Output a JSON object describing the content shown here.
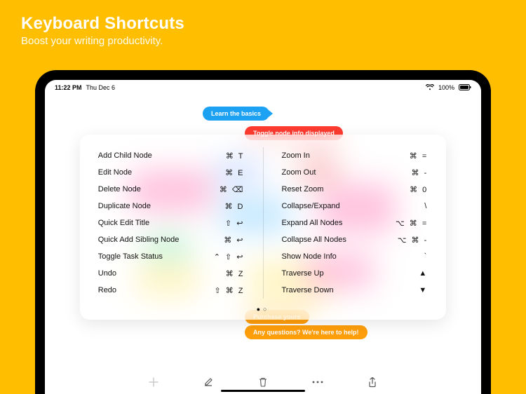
{
  "promo": {
    "title": "Keyboard Shortcuts",
    "subtitle": "Boost your writing productivity."
  },
  "statusBar": {
    "time": "11:22 PM",
    "date": "Thu Dec 6",
    "battery": "100%"
  },
  "background_nodes": {
    "learn_basics": "Learn the basics",
    "toggle_info": "Toggle node info displayed",
    "purchase": "Purchase yours",
    "questions": "Any questions? We're here to help!"
  },
  "shortcuts": {
    "left": [
      {
        "label": "Add Child Node",
        "keys": "⌘ T"
      },
      {
        "label": "Edit Node",
        "keys": "⌘ E"
      },
      {
        "label": "Delete Node",
        "keys": "⌘ ⌫"
      },
      {
        "label": "Duplicate Node",
        "keys": "⌘ D"
      },
      {
        "label": "Quick Edit Title",
        "keys": "⇧ ↩"
      },
      {
        "label": "Quick Add Sibling Node",
        "keys": "⌘ ↩"
      },
      {
        "label": "Toggle Task Status",
        "keys": "⌃ ⇧ ↩"
      },
      {
        "label": "Undo",
        "keys": "⌘ Z"
      },
      {
        "label": "Redo",
        "keys": "⇧ ⌘ Z"
      }
    ],
    "right": [
      {
        "label": "Zoom In",
        "keys": "⌘ ="
      },
      {
        "label": "Zoom Out",
        "keys": "⌘ -"
      },
      {
        "label": "Reset Zoom",
        "keys": "⌘ 0"
      },
      {
        "label": "Collapse/Expand",
        "keys": "\\"
      },
      {
        "label": "Expand All Nodes",
        "keys": "⌥ ⌘ ="
      },
      {
        "label": "Collapse All Nodes",
        "keys": "⌥ ⌘ -"
      },
      {
        "label": "Show Node Info",
        "keys": "`"
      },
      {
        "label": "Traverse Up",
        "keys": "▲"
      },
      {
        "label": "Traverse Down",
        "keys": "▼"
      }
    ]
  },
  "pager": {
    "current": 1,
    "total": 2
  },
  "toolbar": {
    "items": [
      "add",
      "compose",
      "trash",
      "more",
      "share"
    ]
  }
}
